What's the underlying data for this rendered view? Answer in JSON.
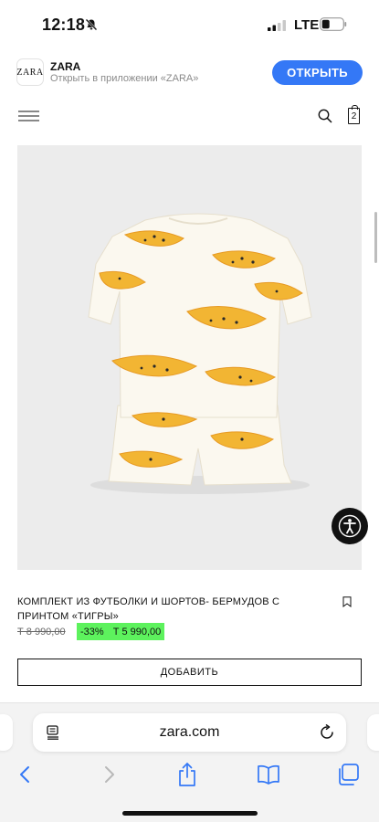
{
  "status_bar": {
    "time": "12:18",
    "network": "LTE",
    "icons": [
      "bell-slash-icon",
      "signal-icon",
      "battery-icon"
    ]
  },
  "app_banner": {
    "logo_text": "ZARA",
    "app_name": "ZARA",
    "subtitle": "Открыть в приложении «ZARA»",
    "open_label": "ОТКРЫТЬ",
    "accent_color": "#3478f6"
  },
  "header": {
    "menu_icon": "hamburger-menu-icon",
    "search_icon": "search-icon",
    "cart_count": "2"
  },
  "product": {
    "title": "КОМПЛЕКТ ИЗ ФУТБОЛКИ И ШОРТОВ- БЕРМУДОВ С ПРИНТОМ «ТИГРЫ»",
    "old_price": "Т 8 990,00",
    "discount": "-33%",
    "new_price": "Т 5 990,00",
    "highlight_color": "#5df25d",
    "add_label": "ДОБАВИТЬ"
  },
  "browser": {
    "url": "zara.com",
    "icons": [
      "reader-icon",
      "reload-icon",
      "back-icon",
      "forward-icon",
      "share-icon",
      "bookmarks-icon",
      "tabs-icon"
    ]
  }
}
